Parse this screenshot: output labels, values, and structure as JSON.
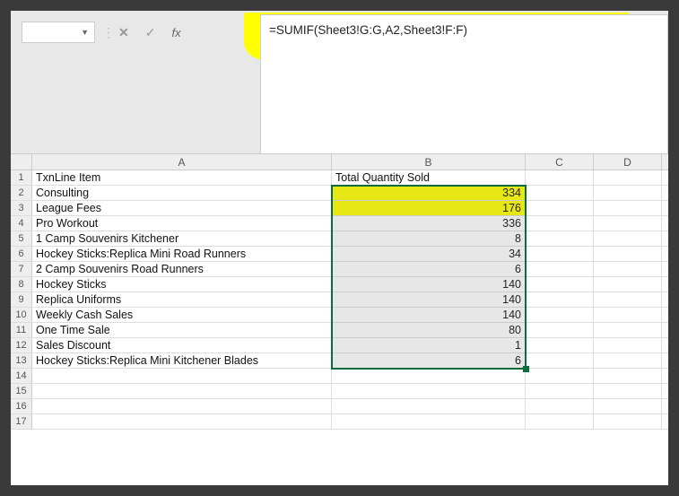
{
  "formula_bar": {
    "name_box_value": "",
    "fx_symbol": "fx",
    "formula": "=SUMIF(Sheet3!G:G,A2,Sheet3!F:F)"
  },
  "columns": [
    "A",
    "B",
    "C",
    "D"
  ],
  "row_numbers": [
    "1",
    "2",
    "3",
    "4",
    "5",
    "6",
    "7",
    "8",
    "9",
    "10",
    "11",
    "12",
    "13",
    "14",
    "15",
    "16",
    "17"
  ],
  "header_row": {
    "A": "TxnLine Item",
    "B": "Total Quantity Sold"
  },
  "data_rows": [
    {
      "A": "Consulting",
      "B": "334"
    },
    {
      "A": "League Fees",
      "B": "176"
    },
    {
      "A": "Pro Workout",
      "B": "336"
    },
    {
      "A": "1 Camp Souvenirs Kitchener",
      "B": "8"
    },
    {
      "A": "Hockey Sticks:Replica Mini Road Runners",
      "B": "34"
    },
    {
      "A": "2 Camp Souvenirs Road Runners",
      "B": "6"
    },
    {
      "A": "Hockey Sticks",
      "B": "140"
    },
    {
      "A": "Replica Uniforms",
      "B": "140"
    },
    {
      "A": "Weekly Cash Sales",
      "B": "140"
    },
    {
      "A": "One Time Sale",
      "B": "80"
    },
    {
      "A": "Sales Discount",
      "B": "1"
    },
    {
      "A": "Hockey Sticks:Replica Mini Kitchener Blades",
      "B": "6"
    }
  ],
  "colors": {
    "highlight": "#ffff00",
    "selection_border": "#0a6b3d"
  }
}
